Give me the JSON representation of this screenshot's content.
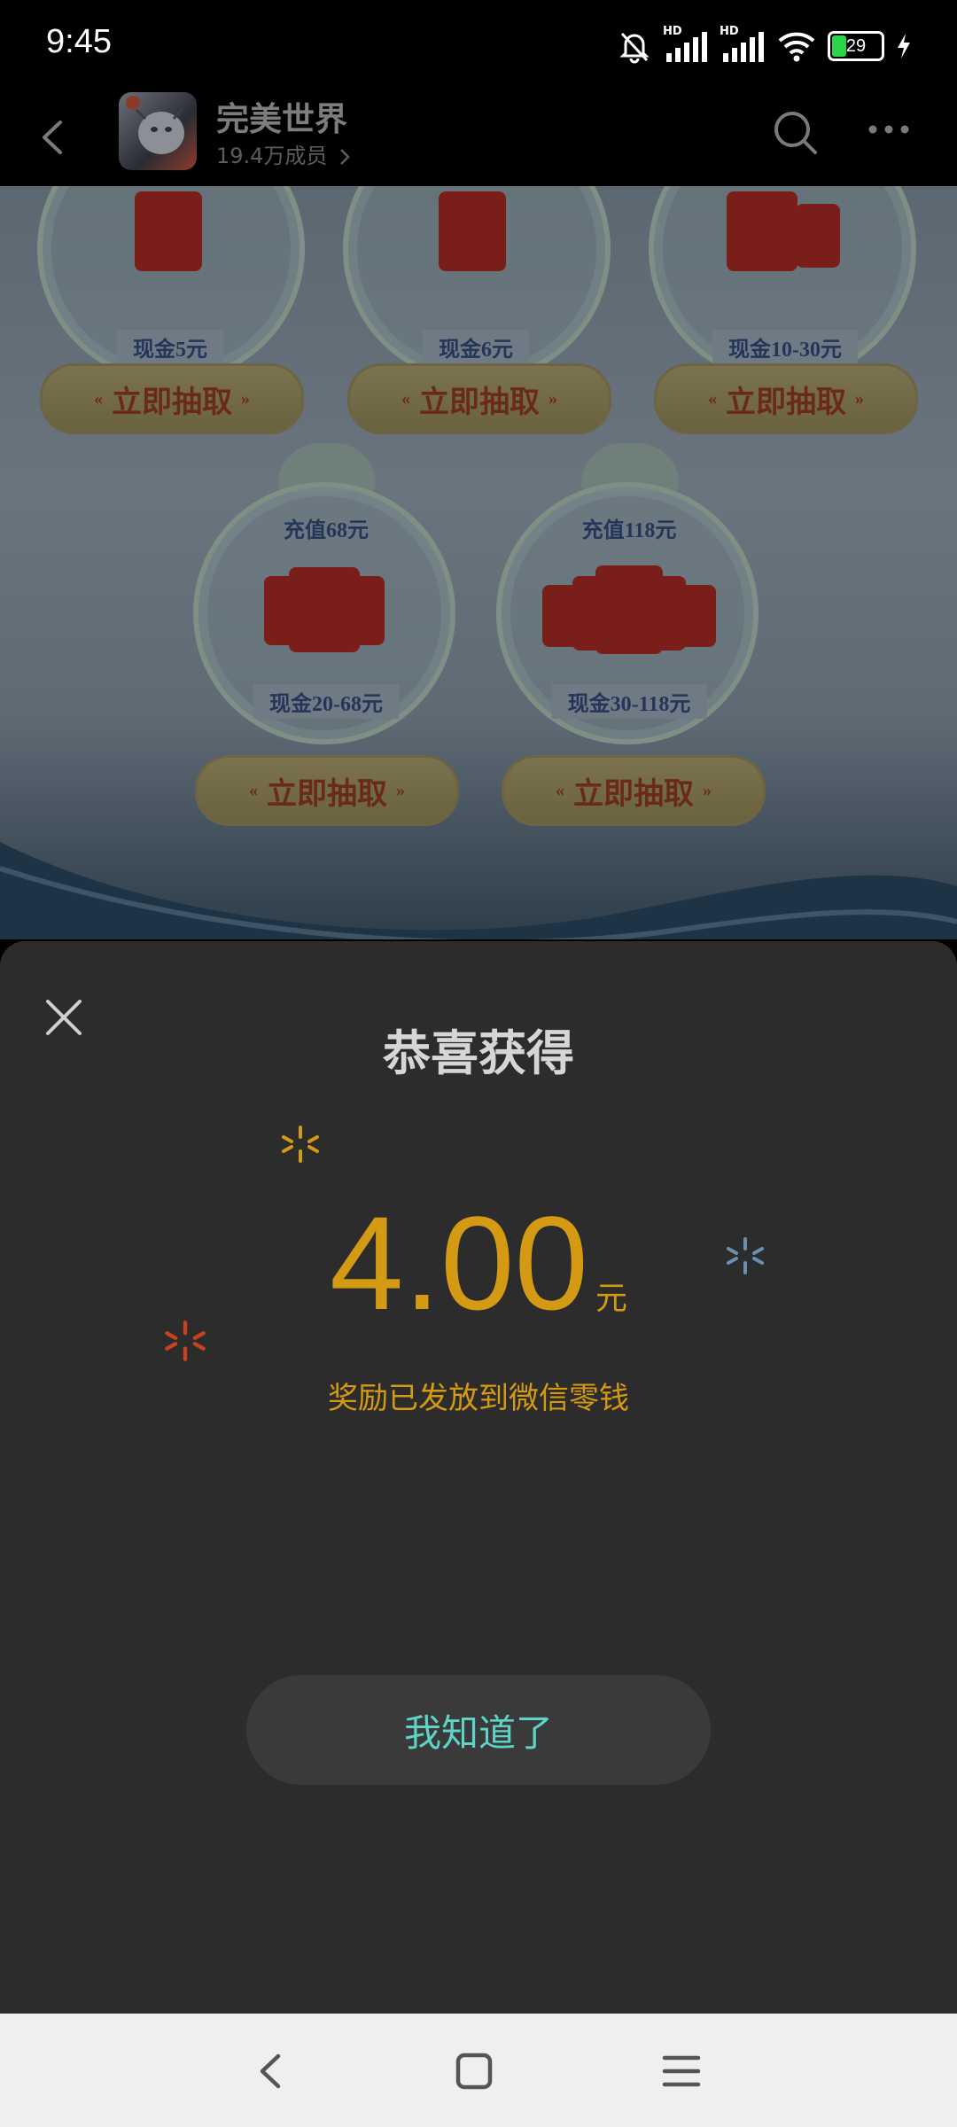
{
  "status_bar": {
    "time": "9:45",
    "battery": "29",
    "hd1": "HD",
    "hd2": "HD"
  },
  "header": {
    "group_name": "完美世界",
    "members": "19.4万成员"
  },
  "prizes_top": [
    {
      "cash": "现金5元"
    },
    {
      "cash": "现金6元"
    },
    {
      "cash": "现金10-30元"
    }
  ],
  "prizes_bottom": [
    {
      "recharge": "充值68元",
      "cash": "现金20-68元"
    },
    {
      "recharge": "充值118元",
      "cash": "现金30-118元"
    }
  ],
  "draw_button_label": "立即抽取",
  "sheet": {
    "title": "恭喜获得",
    "amount": "4.00",
    "unit": "元",
    "note": "奖励已发放到微信零钱",
    "confirm": "我知道了"
  },
  "colors": {
    "accent_gold": "#d49a13",
    "confirm_text": "#5fd3c8",
    "sheet_bg": "#2c2c2c"
  }
}
